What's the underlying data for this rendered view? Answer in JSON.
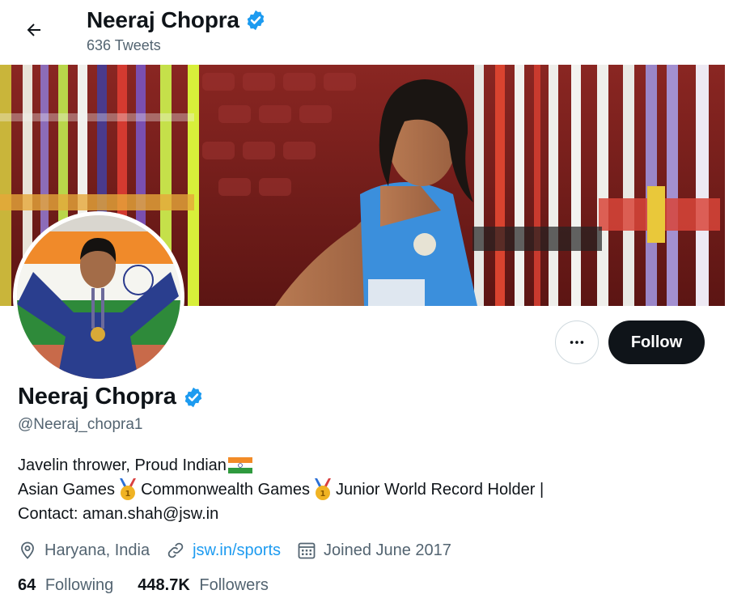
{
  "header": {
    "name": "Neeraj Chopra",
    "tweet_count": "636 Tweets"
  },
  "profile": {
    "name": "Neeraj Chopra",
    "handle": "@Neeraj_chopra1",
    "verified": true,
    "bio_line1": "Javelin thrower, Proud Indian",
    "bio_line2_a": "Asian Games",
    "bio_line2_b": "Commonwealth Games",
    "bio_line2_c": "Junior World Record Holder |",
    "bio_line3": "Contact: aman.shah@jsw.in",
    "location": "Haryana, India",
    "website": "jsw.in/sports",
    "joined": "Joined June 2017",
    "following_count": "64",
    "following_label": "Following",
    "followers_count": "448.7K",
    "followers_label": "Followers"
  },
  "actions": {
    "follow_label": "Follow",
    "more_icon": "more-horizontal-icon",
    "back_icon": "arrow-left-icon"
  },
  "colors": {
    "accent": "#1d9bf0",
    "text": "#0f1419",
    "muted": "#536471",
    "follow_bg": "#0f1419"
  }
}
